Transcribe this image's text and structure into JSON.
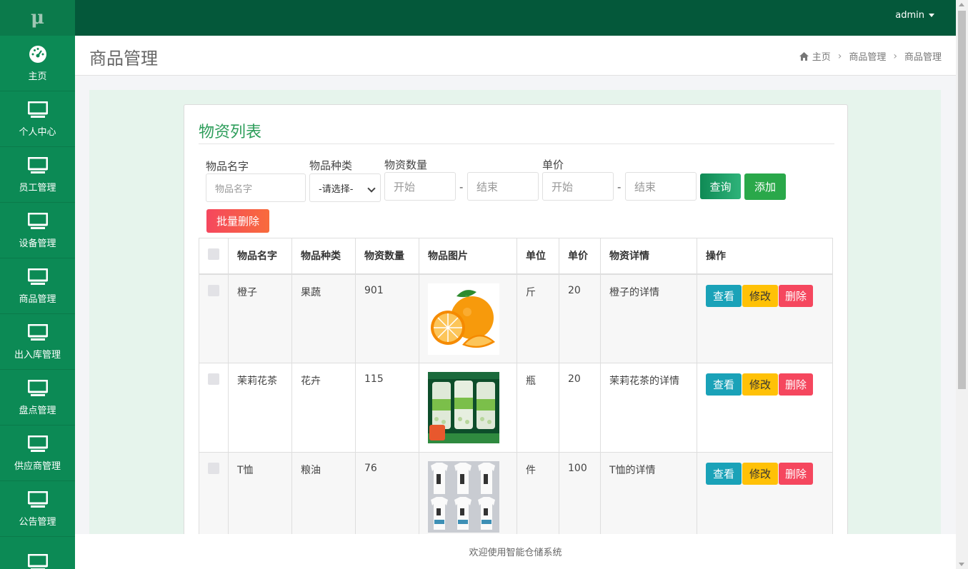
{
  "logo": "μ",
  "sidebar": {
    "items": [
      {
        "label": "主页",
        "icon": "dashboard-icon"
      },
      {
        "label": "个人中心",
        "icon": "monitor-icon"
      },
      {
        "label": "员工管理",
        "icon": "monitor-icon"
      },
      {
        "label": "设备管理",
        "icon": "monitor-icon"
      },
      {
        "label": "商品管理",
        "icon": "monitor-icon"
      },
      {
        "label": "出入库管理",
        "icon": "monitor-icon"
      },
      {
        "label": "盘点管理",
        "icon": "monitor-icon"
      },
      {
        "label": "供应商管理",
        "icon": "monitor-icon"
      },
      {
        "label": "公告管理",
        "icon": "monitor-icon"
      },
      {
        "label": "",
        "icon": "monitor-icon"
      }
    ]
  },
  "topbar": {
    "user": "admin"
  },
  "header": {
    "title": "商品管理",
    "breadcrumb": [
      "主页",
      "商品管理",
      "商品管理"
    ]
  },
  "card": {
    "title": "物资列表"
  },
  "filters": {
    "name_label": "物品名字",
    "name_placeholder": "物品名字",
    "type_label": "物品种类",
    "type_selected": "-请选择-",
    "qty_label": "物资数量",
    "qty_start": "开始",
    "qty_end": "结束",
    "price_label": "单价",
    "price_start": "开始",
    "price_end": "结束",
    "dash": "-",
    "query_label": "查询",
    "add_label": "添加",
    "batch_delete_label": "批量删除"
  },
  "table": {
    "columns": [
      "物品名字",
      "物品种类",
      "物资数量",
      "物品图片",
      "单位",
      "单价",
      "物资详情",
      "操作"
    ],
    "rows": [
      {
        "name": "橙子",
        "type": "果蔬",
        "qty": "901",
        "unit": "斤",
        "price": "20",
        "detail": "橙子的详情",
        "image": "orange"
      },
      {
        "name": "茉莉花茶",
        "type": "花卉",
        "qty": "115",
        "unit": "瓶",
        "price": "20",
        "detail": "茉莉花茶的详情",
        "image": "tea"
      },
      {
        "name": "T恤",
        "type": "粮油",
        "qty": "76",
        "unit": "件",
        "price": "100",
        "detail": "T恤的详情",
        "image": "tshirt"
      }
    ],
    "actions": {
      "view": "查看",
      "edit": "修改",
      "delete": "删除"
    }
  },
  "footer": "欢迎使用智能仓储系统",
  "colors": {
    "sidebar": "#0c8a55",
    "topbar": "#04583a",
    "accent": "#2e9e5b",
    "danger": "#f5475e",
    "warning": "#ffc107",
    "info": "#1aa2b8"
  }
}
